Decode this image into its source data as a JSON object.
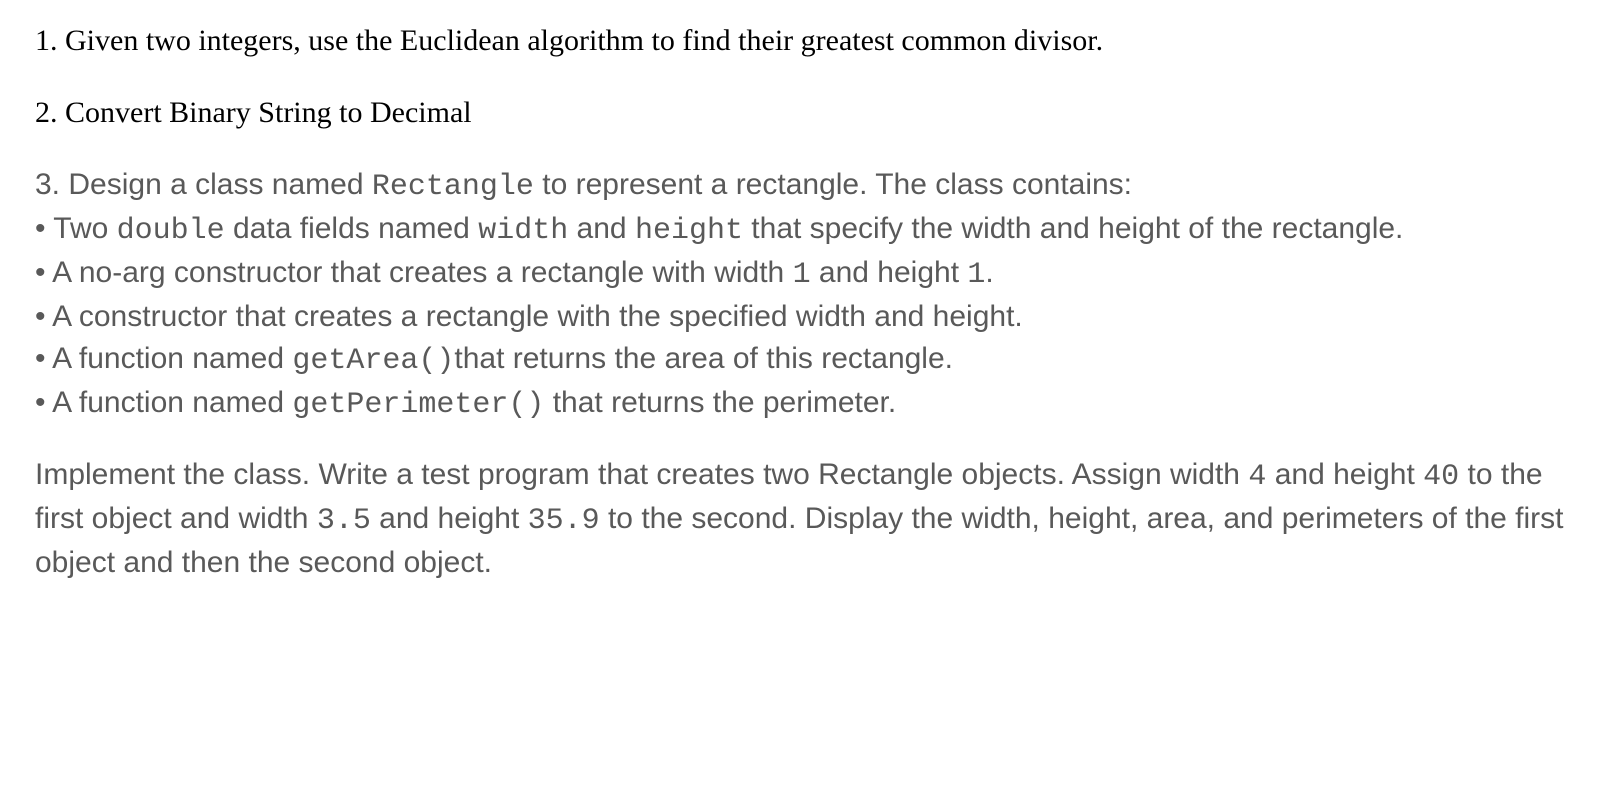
{
  "q1": {
    "num": "1.",
    "text": "Given two integers, use the Euclidean algorithm to find their greatest common divisor."
  },
  "q2": {
    "num": "2.",
    "text": "Convert Binary String to Decimal"
  },
  "q3": {
    "intro": {
      "num": "3.",
      "t1": "Design a class named ",
      "m1": "Rectangle",
      "t2": " to represent a rectangle. The class contains:"
    },
    "b1": {
      "t1": "• Two ",
      "m1": "double",
      "t2": " data fields named ",
      "m2": "width",
      "t3": " and ",
      "m3": "height",
      "t4": " that specify the width and height of the rectangle."
    },
    "b2": {
      "t1": "• A no-arg constructor that creates a rectangle with width ",
      "m1": "1",
      "t2": "  and height ",
      "m2": "1",
      "t3": "."
    },
    "b3": {
      "t1": "• A constructor that creates a rectangle with the specified width and height."
    },
    "b4": {
      "t1": "• A function named ",
      "m1": "getArea()",
      "t2": "that returns the area of this rectangle."
    },
    "b5": {
      "t1": "• A function named ",
      "m1": "getPerimeter()",
      "t2": "  that returns the perimeter."
    },
    "impl": {
      "t1": "Implement the class. Write a test program that creates two Rectangle objects. Assign width ",
      "m1": "4",
      "t2": " and height ",
      "m2": "40",
      "t3": " to the first object and width ",
      "m3": "3.5",
      "t4": "  and height ",
      "m4": "35.9",
      "t5": " to the second. Display the width, height, area, and perimeters of the first object and then the second object."
    }
  }
}
